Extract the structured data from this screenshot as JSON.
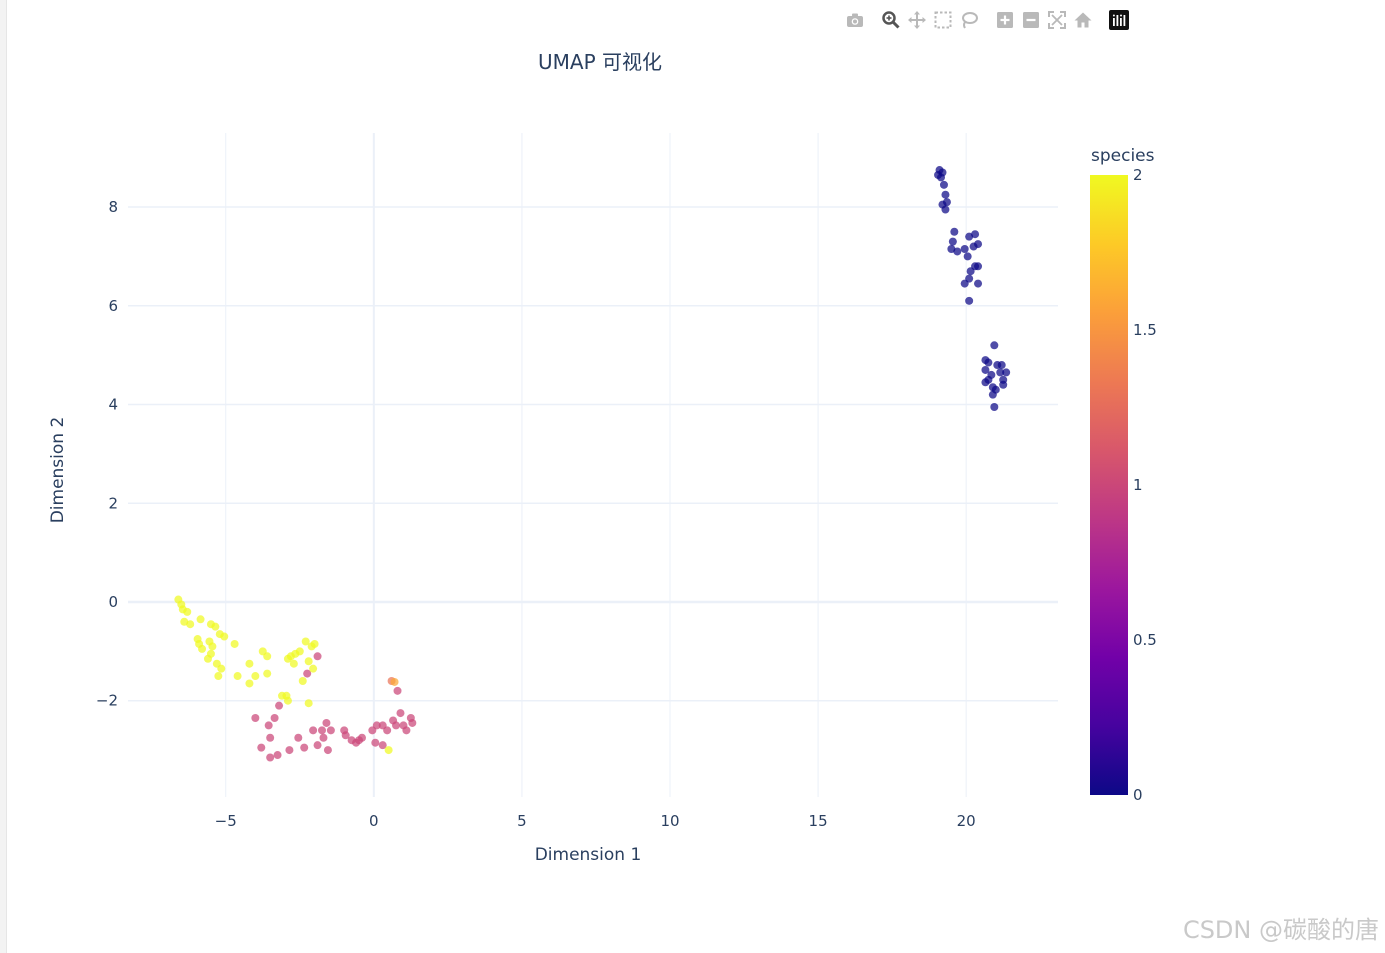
{
  "title": "UMAP 可视化",
  "watermark": "CSDN @碳酸的唐",
  "modebar": [
    {
      "name": "camera-icon",
      "tooltip": "Download plot as a png"
    },
    {
      "name": "zoom-icon",
      "tooltip": "Zoom",
      "active": true
    },
    {
      "name": "pan-icon",
      "tooltip": "Pan"
    },
    {
      "name": "box-select-icon",
      "tooltip": "Box Select"
    },
    {
      "name": "lasso-select-icon",
      "tooltip": "Lasso Select"
    },
    {
      "name": "zoom-in-icon",
      "tooltip": "Zoom in"
    },
    {
      "name": "zoom-out-icon",
      "tooltip": "Zoom out"
    },
    {
      "name": "autoscale-icon",
      "tooltip": "Autoscale"
    },
    {
      "name": "reset-axes-icon",
      "tooltip": "Reset axes"
    },
    {
      "name": "plotly-logo-icon",
      "tooltip": "Produced with Plotly"
    }
  ],
  "colors": {
    "text": "#2a3f5f",
    "grid": "#ebf0f8",
    "zeroline": "#ebf0f8"
  },
  "chart_data": {
    "type": "scatter",
    "title": "UMAP 可视化",
    "xlabel": "Dimension 1",
    "ylabel": "Dimension 2",
    "xlim": [
      -8.3,
      23.1
    ],
    "ylim": [
      -3.95,
      9.5
    ],
    "xticks": [
      -5,
      0,
      5,
      10,
      15,
      20
    ],
    "xtick_labels": [
      "−5",
      "0",
      "5",
      "10",
      "15",
      "20"
    ],
    "yticks": [
      -2,
      0,
      2,
      4,
      6,
      8
    ],
    "ytick_labels": [
      "−2",
      "0",
      "2",
      "4",
      "6",
      "8"
    ],
    "grid": true,
    "colorbar": {
      "title": "species",
      "range": [
        0,
        2
      ],
      "ticks": [
        0,
        0.5,
        1,
        1.5,
        2
      ],
      "tick_labels": [
        "0",
        "0.5",
        "1",
        "1.5",
        "2"
      ],
      "colorscale": [
        "#0d0887",
        "#46039f",
        "#7201a8",
        "#9c179e",
        "#bd3786",
        "#d8576b",
        "#ed7953",
        "#fb9f3a",
        "#fdca26",
        "#f0f921"
      ]
    },
    "points": [
      {
        "x": 19.1,
        "y": 8.75,
        "c": 0
      },
      {
        "x": 19.15,
        "y": 8.6,
        "c": 0
      },
      {
        "x": 19.05,
        "y": 8.65,
        "c": 0
      },
      {
        "x": 19.2,
        "y": 8.7,
        "c": 0
      },
      {
        "x": 19.25,
        "y": 8.45,
        "c": 0
      },
      {
        "x": 19.3,
        "y": 8.25,
        "c": 0
      },
      {
        "x": 19.35,
        "y": 8.1,
        "c": 0
      },
      {
        "x": 19.2,
        "y": 8.05,
        "c": 0
      },
      {
        "x": 19.3,
        "y": 7.95,
        "c": 0
      },
      {
        "x": 19.6,
        "y": 7.5,
        "c": 0
      },
      {
        "x": 19.55,
        "y": 7.3,
        "c": 0
      },
      {
        "x": 19.5,
        "y": 7.15,
        "c": 0
      },
      {
        "x": 19.7,
        "y": 7.1,
        "c": 0
      },
      {
        "x": 19.95,
        "y": 7.15,
        "c": 0
      },
      {
        "x": 20.1,
        "y": 7.4,
        "c": 0
      },
      {
        "x": 20.3,
        "y": 7.45,
        "c": 0
      },
      {
        "x": 20.4,
        "y": 7.25,
        "c": 0
      },
      {
        "x": 20.25,
        "y": 7.2,
        "c": 0
      },
      {
        "x": 20.05,
        "y": 7.0,
        "c": 0
      },
      {
        "x": 20.3,
        "y": 6.8,
        "c": 0
      },
      {
        "x": 20.4,
        "y": 6.8,
        "c": 0
      },
      {
        "x": 20.15,
        "y": 6.7,
        "c": 0
      },
      {
        "x": 20.1,
        "y": 6.55,
        "c": 0
      },
      {
        "x": 19.95,
        "y": 6.45,
        "c": 0
      },
      {
        "x": 20.4,
        "y": 6.45,
        "c": 0
      },
      {
        "x": 20.1,
        "y": 6.1,
        "c": 0
      },
      {
        "x": 20.95,
        "y": 5.2,
        "c": 0
      },
      {
        "x": 20.65,
        "y": 4.9,
        "c": 0
      },
      {
        "x": 20.75,
        "y": 4.85,
        "c": 0
      },
      {
        "x": 21.05,
        "y": 4.8,
        "c": 0
      },
      {
        "x": 21.2,
        "y": 4.8,
        "c": 0
      },
      {
        "x": 20.65,
        "y": 4.7,
        "c": 0
      },
      {
        "x": 21.15,
        "y": 4.65,
        "c": 0
      },
      {
        "x": 21.35,
        "y": 4.65,
        "c": 0
      },
      {
        "x": 20.85,
        "y": 4.6,
        "c": 0
      },
      {
        "x": 20.75,
        "y": 4.5,
        "c": 0
      },
      {
        "x": 21.25,
        "y": 4.5,
        "c": 0
      },
      {
        "x": 20.65,
        "y": 4.45,
        "c": 0
      },
      {
        "x": 21.25,
        "y": 4.4,
        "c": 0
      },
      {
        "x": 20.9,
        "y": 4.35,
        "c": 0
      },
      {
        "x": 21.0,
        "y": 4.3,
        "c": 0
      },
      {
        "x": 20.9,
        "y": 4.2,
        "c": 0
      },
      {
        "x": 20.95,
        "y": 3.95,
        "c": 0
      },
      {
        "x": -4.0,
        "y": -2.35,
        "c": 1
      },
      {
        "x": -3.8,
        "y": -2.95,
        "c": 1
      },
      {
        "x": -3.55,
        "y": -2.5,
        "c": 1
      },
      {
        "x": -3.5,
        "y": -2.75,
        "c": 1
      },
      {
        "x": -3.5,
        "y": -3.15,
        "c": 1
      },
      {
        "x": -3.35,
        "y": -2.35,
        "c": 1
      },
      {
        "x": -3.2,
        "y": -2.1,
        "c": 1
      },
      {
        "x": -3.25,
        "y": -3.1,
        "c": 1
      },
      {
        "x": -2.85,
        "y": -3.0,
        "c": 1
      },
      {
        "x": -2.55,
        "y": -2.75,
        "c": 1
      },
      {
        "x": -2.35,
        "y": -2.95,
        "c": 1
      },
      {
        "x": -2.05,
        "y": -2.6,
        "c": 1
      },
      {
        "x": -1.9,
        "y": -2.9,
        "c": 1
      },
      {
        "x": -1.75,
        "y": -2.6,
        "c": 1
      },
      {
        "x": -1.7,
        "y": -2.75,
        "c": 1
      },
      {
        "x": -1.6,
        "y": -2.45,
        "c": 1
      },
      {
        "x": -1.55,
        "y": -3.0,
        "c": 1
      },
      {
        "x": -1.45,
        "y": -2.6,
        "c": 1
      },
      {
        "x": -1.9,
        "y": -1.1,
        "c": 1
      },
      {
        "x": -2.25,
        "y": -1.45,
        "c": 1
      },
      {
        "x": -1.0,
        "y": -2.6,
        "c": 1
      },
      {
        "x": -0.95,
        "y": -2.7,
        "c": 1
      },
      {
        "x": -0.75,
        "y": -2.8,
        "c": 1
      },
      {
        "x": -0.6,
        "y": -2.85,
        "c": 1
      },
      {
        "x": -0.5,
        "y": -2.8,
        "c": 1
      },
      {
        "x": -0.4,
        "y": -2.75,
        "c": 1
      },
      {
        "x": -0.05,
        "y": -2.6,
        "c": 1
      },
      {
        "x": 0.1,
        "y": -2.5,
        "c": 1
      },
      {
        "x": 0.3,
        "y": -2.5,
        "c": 1
      },
      {
        "x": 0.45,
        "y": -2.6,
        "c": 1
      },
      {
        "x": 0.05,
        "y": -2.85,
        "c": 1
      },
      {
        "x": 0.3,
        "y": -2.9,
        "c": 1
      },
      {
        "x": 0.65,
        "y": -2.4,
        "c": 1
      },
      {
        "x": 0.75,
        "y": -2.5,
        "c": 1
      },
      {
        "x": 0.9,
        "y": -2.25,
        "c": 1
      },
      {
        "x": 1.0,
        "y": -2.5,
        "c": 1
      },
      {
        "x": 1.1,
        "y": -2.6,
        "c": 1
      },
      {
        "x": 1.25,
        "y": -2.35,
        "c": 1
      },
      {
        "x": 1.3,
        "y": -2.45,
        "c": 1
      },
      {
        "x": 0.8,
        "y": -1.8,
        "c": 1
      },
      {
        "x": 0.6,
        "y": -1.6,
        "c": 1.3
      },
      {
        "x": 0.7,
        "y": -1.62,
        "c": 1.6
      },
      {
        "x": 0.5,
        "y": -3.0,
        "c": 2
      },
      {
        "x": -6.6,
        "y": 0.05,
        "c": 2
      },
      {
        "x": -6.5,
        "y": -0.05,
        "c": 2
      },
      {
        "x": -6.45,
        "y": -0.15,
        "c": 2
      },
      {
        "x": -6.3,
        "y": -0.2,
        "c": 2
      },
      {
        "x": -6.4,
        "y": -0.4,
        "c": 2
      },
      {
        "x": -6.2,
        "y": -0.45,
        "c": 2
      },
      {
        "x": -5.85,
        "y": -0.35,
        "c": 2
      },
      {
        "x": -5.5,
        "y": -0.45,
        "c": 2
      },
      {
        "x": -5.35,
        "y": -0.5,
        "c": 2
      },
      {
        "x": -5.2,
        "y": -0.65,
        "c": 2
      },
      {
        "x": -5.05,
        "y": -0.7,
        "c": 2
      },
      {
        "x": -5.95,
        "y": -0.75,
        "c": 2
      },
      {
        "x": -5.9,
        "y": -0.85,
        "c": 2
      },
      {
        "x": -5.55,
        "y": -0.8,
        "c": 2
      },
      {
        "x": -5.45,
        "y": -0.9,
        "c": 2
      },
      {
        "x": -5.8,
        "y": -0.95,
        "c": 2
      },
      {
        "x": -4.7,
        "y": -0.85,
        "c": 2
      },
      {
        "x": -5.5,
        "y": -1.05,
        "c": 2
      },
      {
        "x": -5.6,
        "y": -1.15,
        "c": 2
      },
      {
        "x": -5.3,
        "y": -1.25,
        "c": 2
      },
      {
        "x": -5.15,
        "y": -1.35,
        "c": 2
      },
      {
        "x": -5.25,
        "y": -1.5,
        "c": 2
      },
      {
        "x": -4.6,
        "y": -1.5,
        "c": 2
      },
      {
        "x": -4.2,
        "y": -1.25,
        "c": 2
      },
      {
        "x": -4.0,
        "y": -1.5,
        "c": 2
      },
      {
        "x": -4.2,
        "y": -1.65,
        "c": 2
      },
      {
        "x": -3.75,
        "y": -1.0,
        "c": 2
      },
      {
        "x": -3.6,
        "y": -1.1,
        "c": 2
      },
      {
        "x": -3.6,
        "y": -1.45,
        "c": 2
      },
      {
        "x": -2.9,
        "y": -1.15,
        "c": 2
      },
      {
        "x": -2.8,
        "y": -1.1,
        "c": 2
      },
      {
        "x": -2.65,
        "y": -1.05,
        "c": 2
      },
      {
        "x": -2.5,
        "y": -1.0,
        "c": 2
      },
      {
        "x": -2.3,
        "y": -0.8,
        "c": 2
      },
      {
        "x": -2.1,
        "y": -0.9,
        "c": 2
      },
      {
        "x": -2.0,
        "y": -0.85,
        "c": 2
      },
      {
        "x": -2.7,
        "y": -1.25,
        "c": 2
      },
      {
        "x": -2.2,
        "y": -1.2,
        "c": 2
      },
      {
        "x": -2.05,
        "y": -1.35,
        "c": 2
      },
      {
        "x": -2.4,
        "y": -1.6,
        "c": 2
      },
      {
        "x": -3.1,
        "y": -1.9,
        "c": 2
      },
      {
        "x": -2.95,
        "y": -1.9,
        "c": 2
      },
      {
        "x": -2.9,
        "y": -2.0,
        "c": 2
      },
      {
        "x": -2.2,
        "y": -2.05,
        "c": 2
      }
    ]
  }
}
